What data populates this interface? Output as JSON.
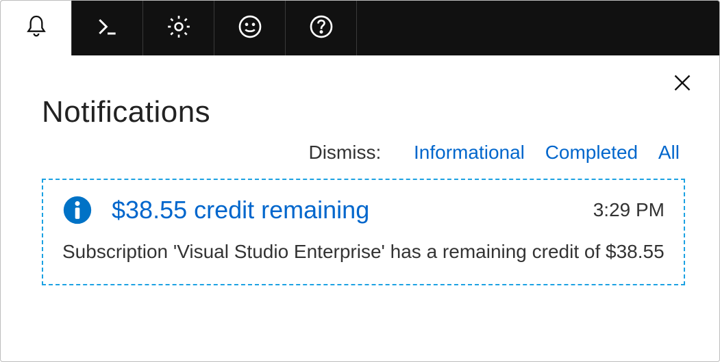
{
  "topbar": {
    "icons": [
      "bell-icon",
      "cloudshell-icon",
      "gear-icon",
      "smiley-icon",
      "help-icon"
    ]
  },
  "panel": {
    "title": "Notifications",
    "dismiss_label": "Dismiss:",
    "dismiss_links": {
      "informational": "Informational",
      "completed": "Completed",
      "all": "All"
    }
  },
  "notification": {
    "title": "$38.55 credit remaining",
    "time": "3:29 PM",
    "body": "Subscription 'Visual Studio Enterprise' has a remaining credit of $38.55"
  }
}
